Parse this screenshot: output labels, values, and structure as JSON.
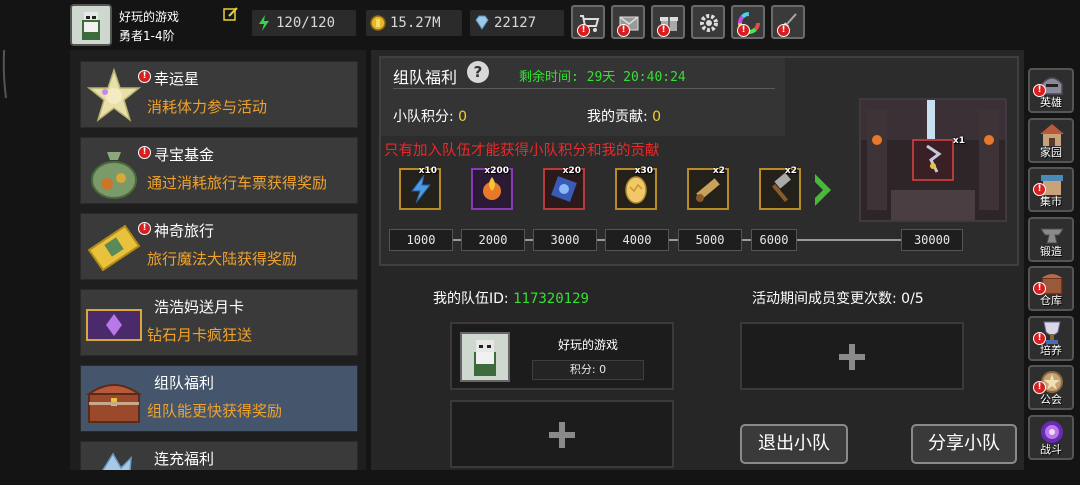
{
  "player": {
    "name": "好玩的游戏",
    "rank": "勇者1-4阶"
  },
  "stats": {
    "stamina": "120/120",
    "gold": "15.27M",
    "diamond": "22127"
  },
  "top_buttons": [
    "shop-icon",
    "mail-icon",
    "gift-icon",
    "settings-icon",
    "color-wheel-icon",
    "broom-icon"
  ],
  "sidebar": {
    "items": [
      {
        "title": "幸运星",
        "subtitle": "消耗体力参与活动",
        "badge": "!",
        "icon": "lucky-star-icon"
      },
      {
        "title": "寻宝基金",
        "subtitle": "通过消耗旅行车票获得奖励",
        "badge": "!",
        "icon": "treasure-bag-icon"
      },
      {
        "title": "神奇旅行",
        "subtitle": "旅行魔法大陆获得奖励",
        "badge": "!",
        "icon": "travel-ticket-icon"
      },
      {
        "title": "浩浩妈送月卡",
        "subtitle": "钻石月卡疯狂送",
        "badge": "",
        "icon": "month-card-icon"
      },
      {
        "title": "组队福利",
        "subtitle": "组队能更快获得奖励",
        "badge": "",
        "icon": "treasure-chest-icon"
      },
      {
        "title": "连充福利",
        "subtitle": "",
        "badge": "",
        "icon": "crystal-icon"
      }
    ]
  },
  "panel": {
    "title": "组队福利",
    "help": "?",
    "remaining_time": "剩余时间: 29天 20:40:24",
    "team_score_label": "小队积分:",
    "team_score_value": "0",
    "contribution_label": "我的贡献:",
    "contribution_value": "0",
    "notice": "只有加入队伍才能获得小队积分和我的贡献"
  },
  "rewards": [
    {
      "qty": "x10",
      "icon": "lightning-icon"
    },
    {
      "qty": "x200",
      "icon": "fire-orb-icon"
    },
    {
      "qty": "x20",
      "icon": "blue-rune-icon"
    },
    {
      "qty": "x30",
      "icon": "egg-icon"
    },
    {
      "qty": "x2",
      "icon": "scroll-icon"
    },
    {
      "qty": "x2",
      "icon": "hammer-icon"
    }
  ],
  "milestones": [
    "1000",
    "2000",
    "3000",
    "4000",
    "5000",
    "6000",
    "30000"
  ],
  "preview": {
    "qty": "x1"
  },
  "team": {
    "id_label": "我的队伍ID:",
    "id_value": "117320129",
    "change_label": "活动期间成员变更次数: 0/5",
    "member_name": "好玩的游戏",
    "member_score": "积分: 0",
    "leave_button": "退出小队",
    "share_button": "分享小队"
  },
  "right_nav": [
    {
      "label": "英雄",
      "badge": "!",
      "icon": "helmet-icon"
    },
    {
      "label": "家园",
      "badge": "",
      "icon": "house-icon"
    },
    {
      "label": "集市",
      "badge": "!",
      "icon": "market-icon"
    },
    {
      "label": "锻造",
      "badge": "",
      "icon": "anvil-icon"
    },
    {
      "label": "仓库",
      "badge": "!",
      "icon": "warehouse-icon"
    },
    {
      "label": "培养",
      "badge": "!",
      "icon": "trophy-icon"
    },
    {
      "label": "公会",
      "badge": "!",
      "icon": "guild-icon"
    },
    {
      "label": "战斗",
      "badge": "",
      "icon": "portal-icon"
    }
  ],
  "colors": {
    "accent_green": "#33e033",
    "accent_orange": "#f0a22c",
    "notice_red": "#f02828",
    "active_item": "#45566c"
  }
}
